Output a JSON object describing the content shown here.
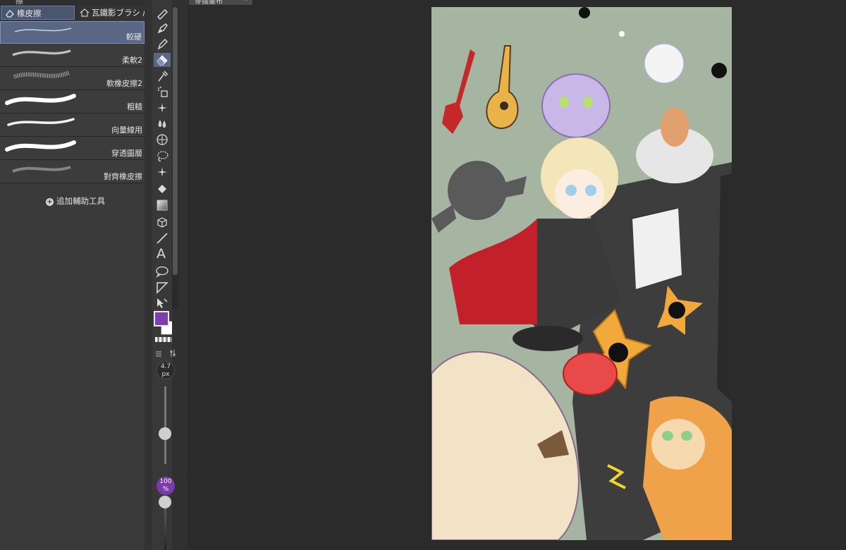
{
  "subtool_panel": {
    "top_label": "擦",
    "tabs": [
      {
        "label": "橡皮擦",
        "icon": "eraser-icon",
        "active": true
      },
      {
        "label": "瓦鐵影ブラシ / De",
        "icon": "house-icon",
        "active": false
      }
    ],
    "brushes": [
      {
        "label": "較硬",
        "selected": true
      },
      {
        "label": "柔軟2",
        "selected": false
      },
      {
        "label": "軟橡皮擦2",
        "selected": false
      },
      {
        "label": "粗糙",
        "selected": false
      },
      {
        "label": "向量線用",
        "selected": false
      },
      {
        "label": "穿透圖層",
        "selected": false
      },
      {
        "label": "對齊橡皮擦",
        "selected": false
      }
    ],
    "add_subtool_label": "追加輔助工具"
  },
  "toolbar": {
    "tools": [
      "pencil-icon",
      "pen-icon",
      "marker-icon",
      "eraser-icon",
      "dropper-icon",
      "fill-spray-icon",
      "sparkle-icon",
      "blend-drops-icon",
      "grid-icon",
      "lasso-icon",
      "magic-wand-icon",
      "paint-bucket-icon",
      "gradient-icon",
      "3d-cube-icon",
      "line-icon",
      "text-icon",
      "speech-balloon-icon",
      "frame-cut-icon",
      "operation-arrow-icon"
    ],
    "active_tool": "eraser-icon",
    "main_color": "#7d3fb0",
    "sub_color": "#ffffff",
    "brush_size": "4.7",
    "brush_size_unit": "px",
    "opacity": "100",
    "opacity_unit": "%"
  },
  "canvas": {
    "tab_label": "穿插畫布",
    "tab_close": "×",
    "background": "#a6b5a1"
  }
}
